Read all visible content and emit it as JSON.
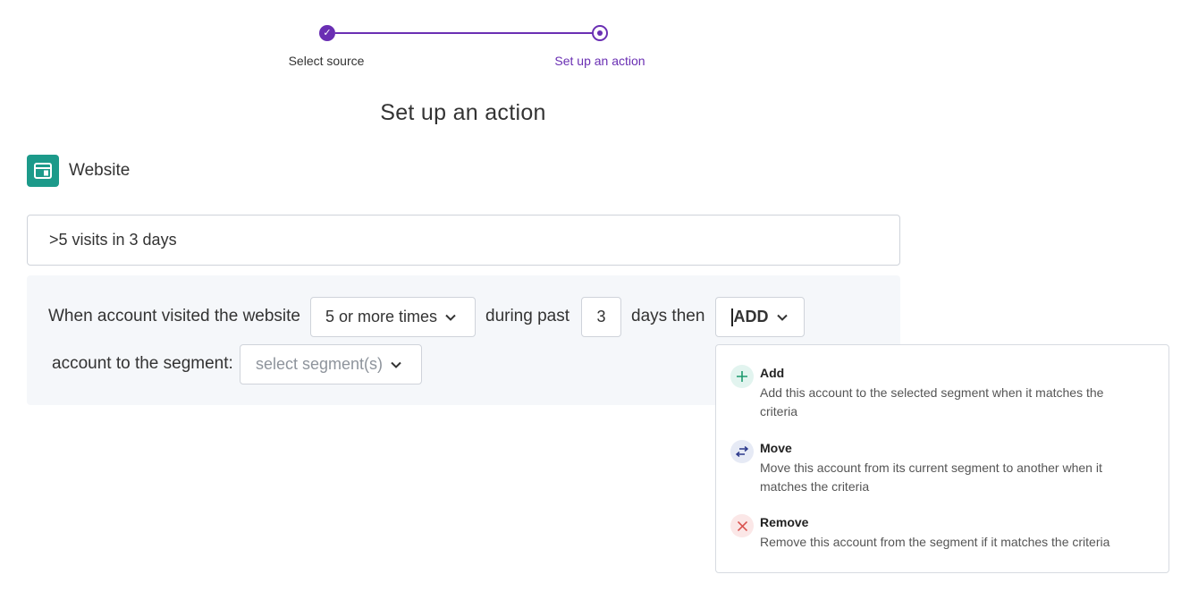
{
  "stepper": {
    "steps": [
      {
        "label": "Select source",
        "state": "done"
      },
      {
        "label": "Set up an action",
        "state": "current"
      }
    ],
    "accent_color": "#6a2fb3"
  },
  "page_title": "Set up an action",
  "source": {
    "icon": "website-icon",
    "label": "Website",
    "icon_color": "#1c9a8a"
  },
  "rule_name": {
    "value": ">5 visits in 3 days"
  },
  "rule": {
    "prefix": "When account visited the website",
    "frequency": "5 or more times",
    "during_past": "during past",
    "days": "3",
    "days_then": "days then",
    "action": "ADD",
    "account_to_segment": "account to the segment:",
    "segment_placeholder": "select segment(s)"
  },
  "action_menu": {
    "options": [
      {
        "icon": "plus-icon",
        "title": "Add",
        "description": "Add this account to the selected segment when it matches the criteria"
      },
      {
        "icon": "swap-arrows-icon",
        "title": "Move",
        "description": "Move this account from its current segment to another when it matches the criteria"
      },
      {
        "icon": "close-icon",
        "title": "Remove",
        "description": "Remove this account from the segment if it matches the criteria"
      }
    ]
  }
}
